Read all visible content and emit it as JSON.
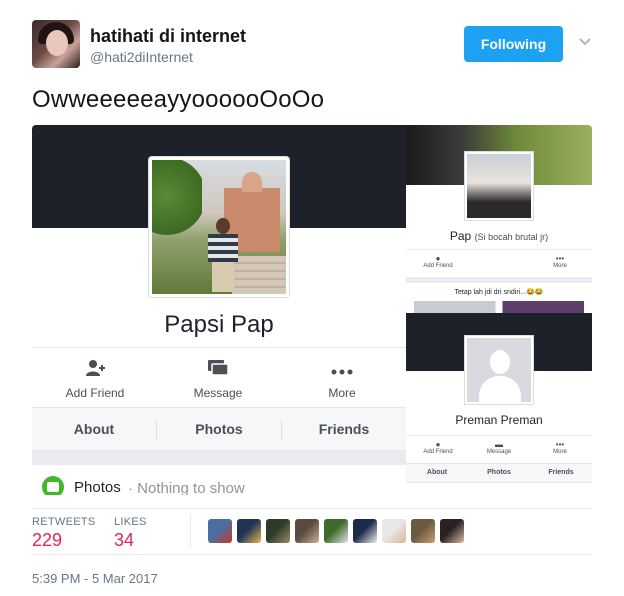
{
  "tweet": {
    "author_name": "hatihati di internet",
    "author_handle": "@hati2diInternet",
    "follow_label": "Following",
    "text": "OwweeeeeayyoooooOoOo",
    "timestamp": "5:39 PM - 5 Mar 2017"
  },
  "stats": {
    "retweets_label": "RETWEETS",
    "retweets_count": "229",
    "likes_label": "LIKES",
    "likes_count": "34"
  },
  "media": {
    "main": {
      "profile_name": "Papsi Pap",
      "actions": [
        "Add Friend",
        "Message",
        "More"
      ],
      "tabs": [
        "About",
        "Photos",
        "Friends"
      ],
      "photos_label": "Photos",
      "photos_note": "· Nothing to show"
    },
    "right_top": {
      "profile_name": "Pap",
      "profile_sub": "(Si bocah brutal jr)",
      "actions": [
        "Add Friend",
        "More"
      ],
      "status": "Tetap lah jdi dri sndiri...😂😂"
    },
    "right_bottom": {
      "profile_name": "Preman Preman",
      "actions": [
        "Add Friend",
        "Message",
        "More"
      ],
      "tabs": [
        "About",
        "Photos",
        "Friends"
      ]
    }
  },
  "likers": [
    {
      "color_a": "#4a6fa5",
      "color_b": "#c0392b"
    },
    {
      "color_a": "#223355",
      "color_b": "#e6b84c"
    },
    {
      "color_a": "#2f3b2a",
      "color_b": "#9a8b6a"
    },
    {
      "color_a": "#5a4a40",
      "color_b": "#c9b39a"
    },
    {
      "color_a": "#3f6b2a",
      "color_b": "#e3e3e3"
    },
    {
      "color_a": "#1c2a4a",
      "color_b": "#f0f0f0"
    },
    {
      "color_a": "#e8e8e8",
      "color_b": "#d9b49a"
    },
    {
      "color_a": "#6a5a40",
      "color_b": "#c9a070"
    },
    {
      "color_a": "#2a2222",
      "color_b": "#d9b8a8"
    }
  ],
  "colors": {
    "follow_button": "#1da1f2",
    "stat_number": "#e0245e",
    "secondary_text": "#657786"
  },
  "icons": {
    "dropdown": "chevron-down-icon",
    "add_friend": "add-friend-icon",
    "message": "message-icon",
    "more": "more-icon",
    "photos": "photos-icon"
  }
}
